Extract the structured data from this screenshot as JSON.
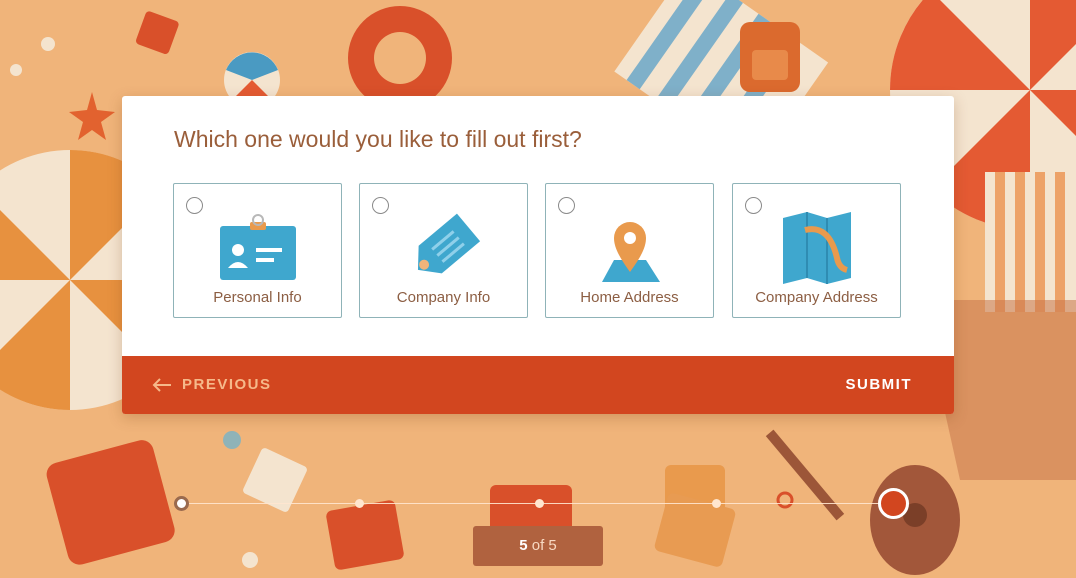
{
  "question": "Which one would you like to fill out first?",
  "options": [
    {
      "label": "Personal Info",
      "icon": "id-badge-icon"
    },
    {
      "label": "Company Info",
      "icon": "tag-icon"
    },
    {
      "label": "Home Address",
      "icon": "map-pin-icon"
    },
    {
      "label": "Company Address",
      "icon": "folded-map-icon"
    }
  ],
  "nav": {
    "previous": "PREVIOUS",
    "submit": "SUBMIT"
  },
  "progress": {
    "current": "5",
    "sep": "of",
    "total": "5",
    "fraction": 1.0
  },
  "colors": {
    "accent": "#D2461F",
    "background": "#F0B47A",
    "icon_blue": "#3FA7CE",
    "icon_orange": "#E99A4D",
    "text_brown": "#9A5E3A"
  }
}
